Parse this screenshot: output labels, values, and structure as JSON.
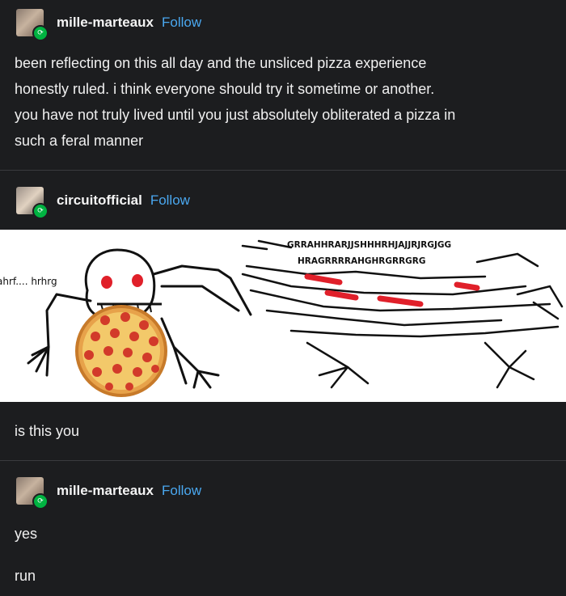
{
  "posts": [
    {
      "username": "mille-marteaux",
      "follow_label": "Follow",
      "lines": [
        "been reflecting on this all day and the unsliced pizza experience",
        "honestly ruled. i think everyone should try it sometime or another.",
        "you have not truly lived until you just absolutely obliterated a pizza in",
        "such a feral manner"
      ]
    },
    {
      "username": "circuitofficial",
      "follow_label": "Follow",
      "image": {
        "left_caption": "ahrf.... hrhrg",
        "scream_line1": "GRRAHHRARJJSHHHRHJAJJRJRGJGG",
        "scream_line2": "HRAGRRRRAHGHRGRRGRG"
      },
      "reply_text": "is this you"
    },
    {
      "username": "mille-marteaux",
      "follow_label": "Follow",
      "lines": [
        "yes",
        "run"
      ]
    }
  ],
  "colors": {
    "background": "#1c1d1f",
    "follow_link": "#4aa8f0",
    "reblog_badge": "#00b341"
  }
}
